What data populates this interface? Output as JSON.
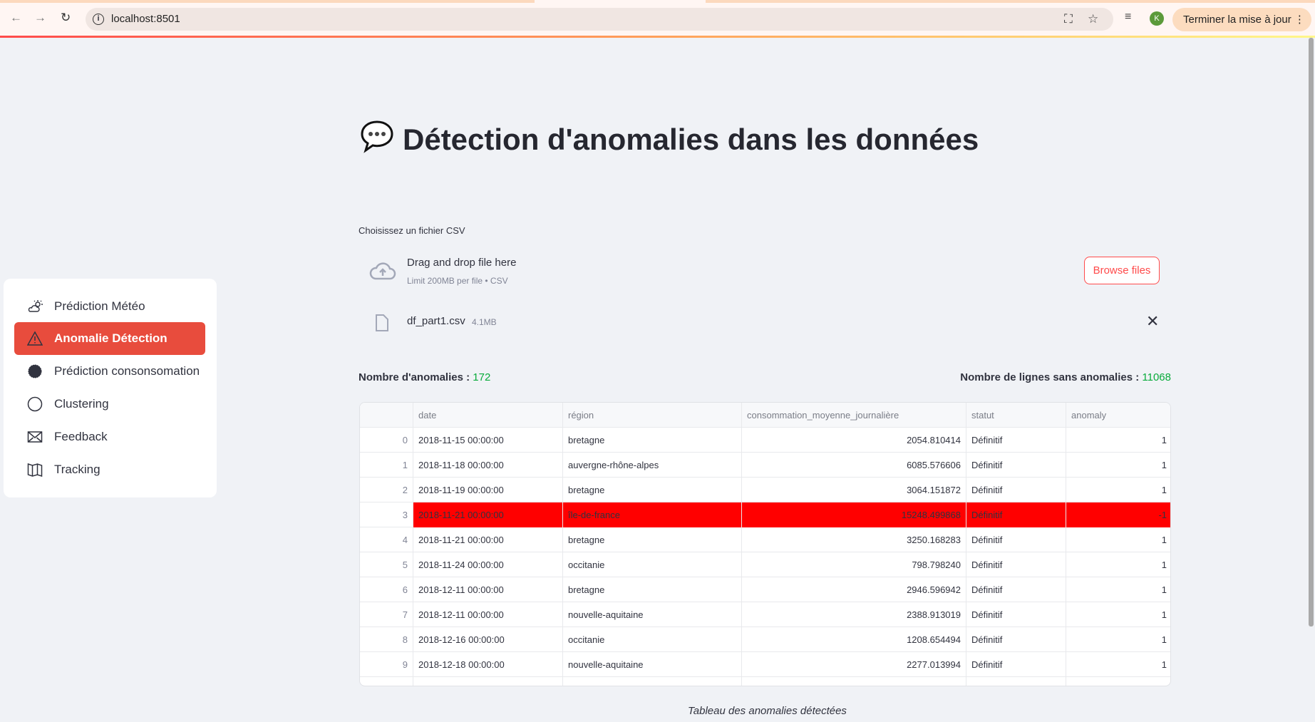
{
  "browser": {
    "url": "localhost:8501",
    "update_label": "Terminer la mise à jour",
    "avatar_letter": "K"
  },
  "sidebar": {
    "items": [
      {
        "label": "Prédiction Météo",
        "icon": "cloud-sun-icon"
      },
      {
        "label": "Anomalie Détection",
        "icon": "warning-icon",
        "active": true
      },
      {
        "label": "Prédiction consonsomation",
        "icon": "chat-bubble-icon"
      },
      {
        "label": "Clustering",
        "icon": "circle-icon"
      },
      {
        "label": "Feedback",
        "icon": "envelope-icon"
      },
      {
        "label": "Tracking",
        "icon": "map-icon"
      }
    ]
  },
  "main": {
    "title": "Détection d'anomalies dans les données",
    "uploader": {
      "label": "Choisissez un fichier CSV",
      "drag_text": "Drag and drop file here",
      "limit_text": "Limit 200MB per file • CSV",
      "browse_label": "Browse files"
    },
    "file": {
      "name": "df_part1.csv",
      "size": "4.1MB"
    },
    "anomalies_label": "Nombre d'anomalies :",
    "anomalies_value": "172",
    "normal_label": "Nombre de lignes sans anomalies :",
    "normal_value": "11068",
    "caption": "Tableau des anomalies détectées"
  },
  "table": {
    "columns": [
      "",
      "date",
      "région",
      "consommation_moyenne_journalière",
      "statut",
      "anomaly"
    ],
    "highlight_color": "#ff0000",
    "rows": [
      [
        "0",
        "2018-11-15 00:00:00",
        "bretagne",
        "2054.810414",
        "Définitif",
        "1"
      ],
      [
        "1",
        "2018-11-18 00:00:00",
        "auvergne-rhône-alpes",
        "6085.576606",
        "Définitif",
        "1"
      ],
      [
        "2",
        "2018-11-19 00:00:00",
        "bretagne",
        "3064.151872",
        "Définitif",
        "1"
      ],
      [
        "3",
        "2018-11-21 00:00:00",
        "île-de-france",
        "15248.499868",
        "Définitif",
        "-1"
      ],
      [
        "4",
        "2018-11-21 00:00:00",
        "bretagne",
        "3250.168283",
        "Définitif",
        "1"
      ],
      [
        "5",
        "2018-11-24 00:00:00",
        "occitanie",
        "798.798240",
        "Définitif",
        "1"
      ],
      [
        "6",
        "2018-12-11 00:00:00",
        "bretagne",
        "2946.596942",
        "Définitif",
        "1"
      ],
      [
        "7",
        "2018-12-11 00:00:00",
        "nouvelle-aquitaine",
        "2388.913019",
        "Définitif",
        "1"
      ],
      [
        "8",
        "2018-12-16 00:00:00",
        "occitanie",
        "1208.654494",
        "Définitif",
        "1"
      ],
      [
        "9",
        "2018-12-18 00:00:00",
        "nouvelle-aquitaine",
        "2277.013994",
        "Définitif",
        "1"
      ]
    ]
  }
}
